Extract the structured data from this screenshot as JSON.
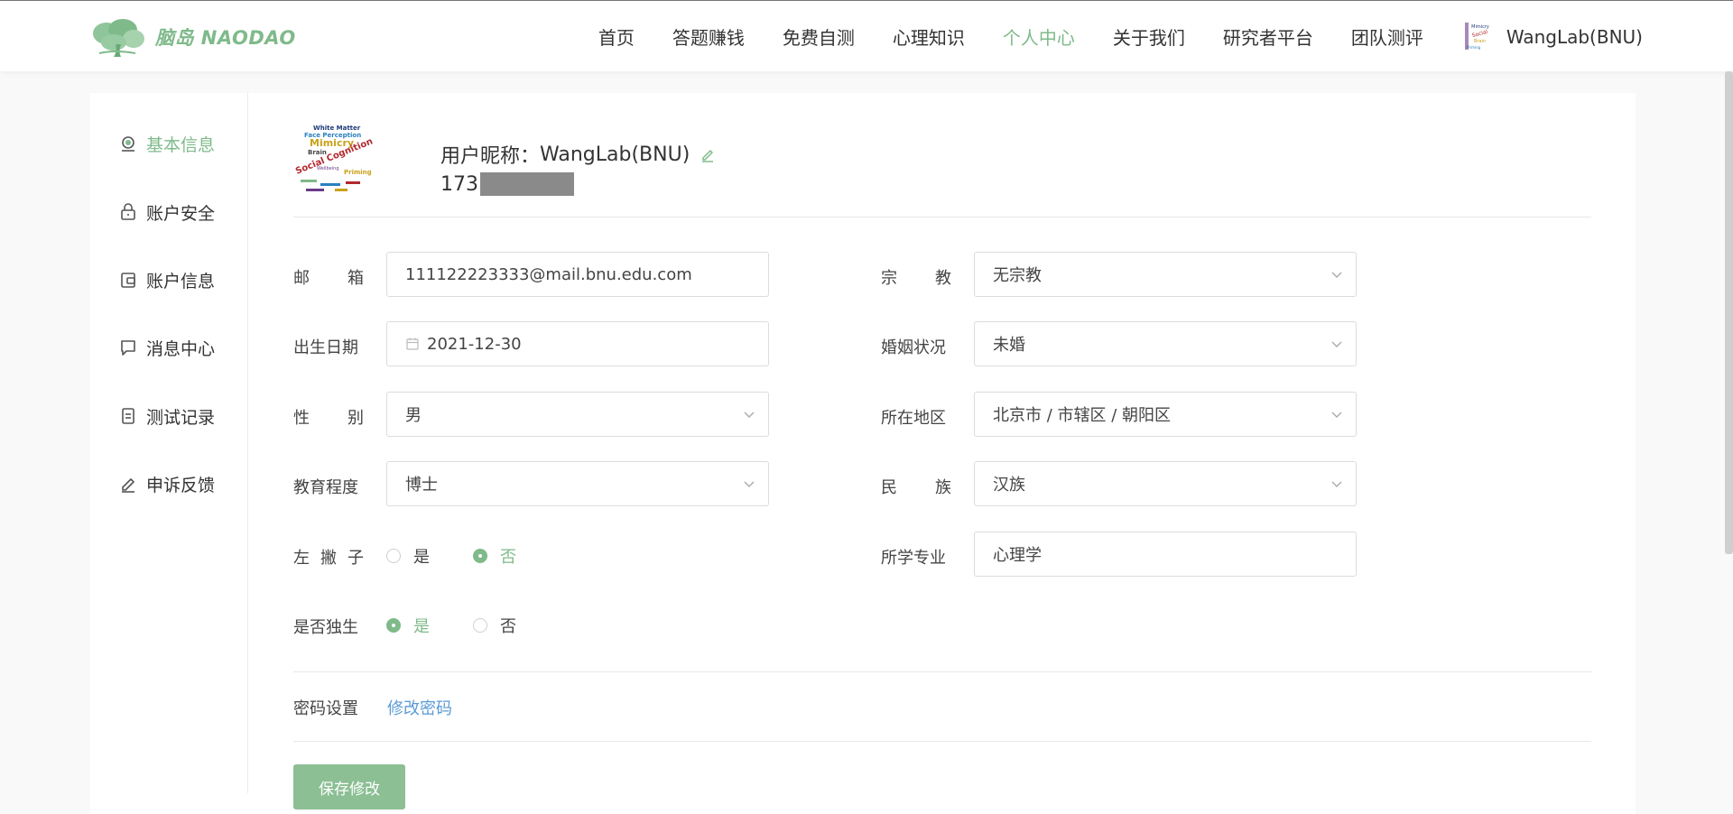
{
  "brand": {
    "logo_text": "脑岛 NAODAO",
    "accent_color": "#7fba8a"
  },
  "nav": {
    "items": [
      {
        "label": "首页",
        "active": false
      },
      {
        "label": "答题赚钱",
        "active": false
      },
      {
        "label": "免费自测",
        "active": false
      },
      {
        "label": "心理知识",
        "active": false
      },
      {
        "label": "个人中心",
        "active": true
      },
      {
        "label": "关于我们",
        "active": false
      },
      {
        "label": "研究者平台",
        "active": false
      },
      {
        "label": "团队测评",
        "active": false
      }
    ],
    "user_name": "WangLab(BNU)"
  },
  "sidebar": {
    "items": [
      {
        "label": "基本信息",
        "icon": "user-icon",
        "active": true
      },
      {
        "label": "账户安全",
        "icon": "lock-icon",
        "active": false
      },
      {
        "label": "账户信息",
        "icon": "wallet-icon",
        "active": false
      },
      {
        "label": "消息中心",
        "icon": "message-icon",
        "active": false
      },
      {
        "label": "测试记录",
        "icon": "document-icon",
        "active": false
      },
      {
        "label": "申诉反馈",
        "icon": "edit-icon",
        "active": false
      }
    ]
  },
  "profile": {
    "nickname_label": "用户昵称：",
    "nickname": "WangLab(BNU)",
    "phone_prefix": "173"
  },
  "form": {
    "email": {
      "label_chars": [
        "邮",
        "箱"
      ],
      "value": "111122223333@mail.bnu.edu.com"
    },
    "religion": {
      "label_chars": [
        "宗",
        "教"
      ],
      "value": "无宗教"
    },
    "birthdate": {
      "label_chars": [
        "出生日期"
      ],
      "value": "2021-12-30"
    },
    "marital": {
      "label_chars": [
        "婚姻状况"
      ],
      "value": "未婚"
    },
    "gender": {
      "label_chars": [
        "性",
        "别"
      ],
      "value": "男"
    },
    "region": {
      "label_chars": [
        "所在地区"
      ],
      "value": "北京市 / 市辖区 / 朝阳区"
    },
    "education": {
      "label_chars": [
        "教育程度"
      ],
      "value": "博士"
    },
    "ethnicity": {
      "label_chars": [
        "民",
        "族"
      ],
      "value": "汉族"
    },
    "left_handed": {
      "label_chars": [
        "左",
        "撇",
        "子"
      ],
      "options": [
        "是",
        "否"
      ],
      "selected": "否"
    },
    "major": {
      "label_chars": [
        "所学专业"
      ],
      "value": "心理学"
    },
    "only_child": {
      "label_chars": [
        "是否独生"
      ],
      "options": [
        "是",
        "否"
      ],
      "selected": "是"
    }
  },
  "password": {
    "label": "密码设置",
    "link": "修改密码"
  },
  "save_button": "保存修改",
  "wordcloud": [
    "White Matter",
    "Face Perception",
    "Mimicry",
    "Brain",
    "Social Cognition",
    "Priming",
    "Wellbeing"
  ]
}
